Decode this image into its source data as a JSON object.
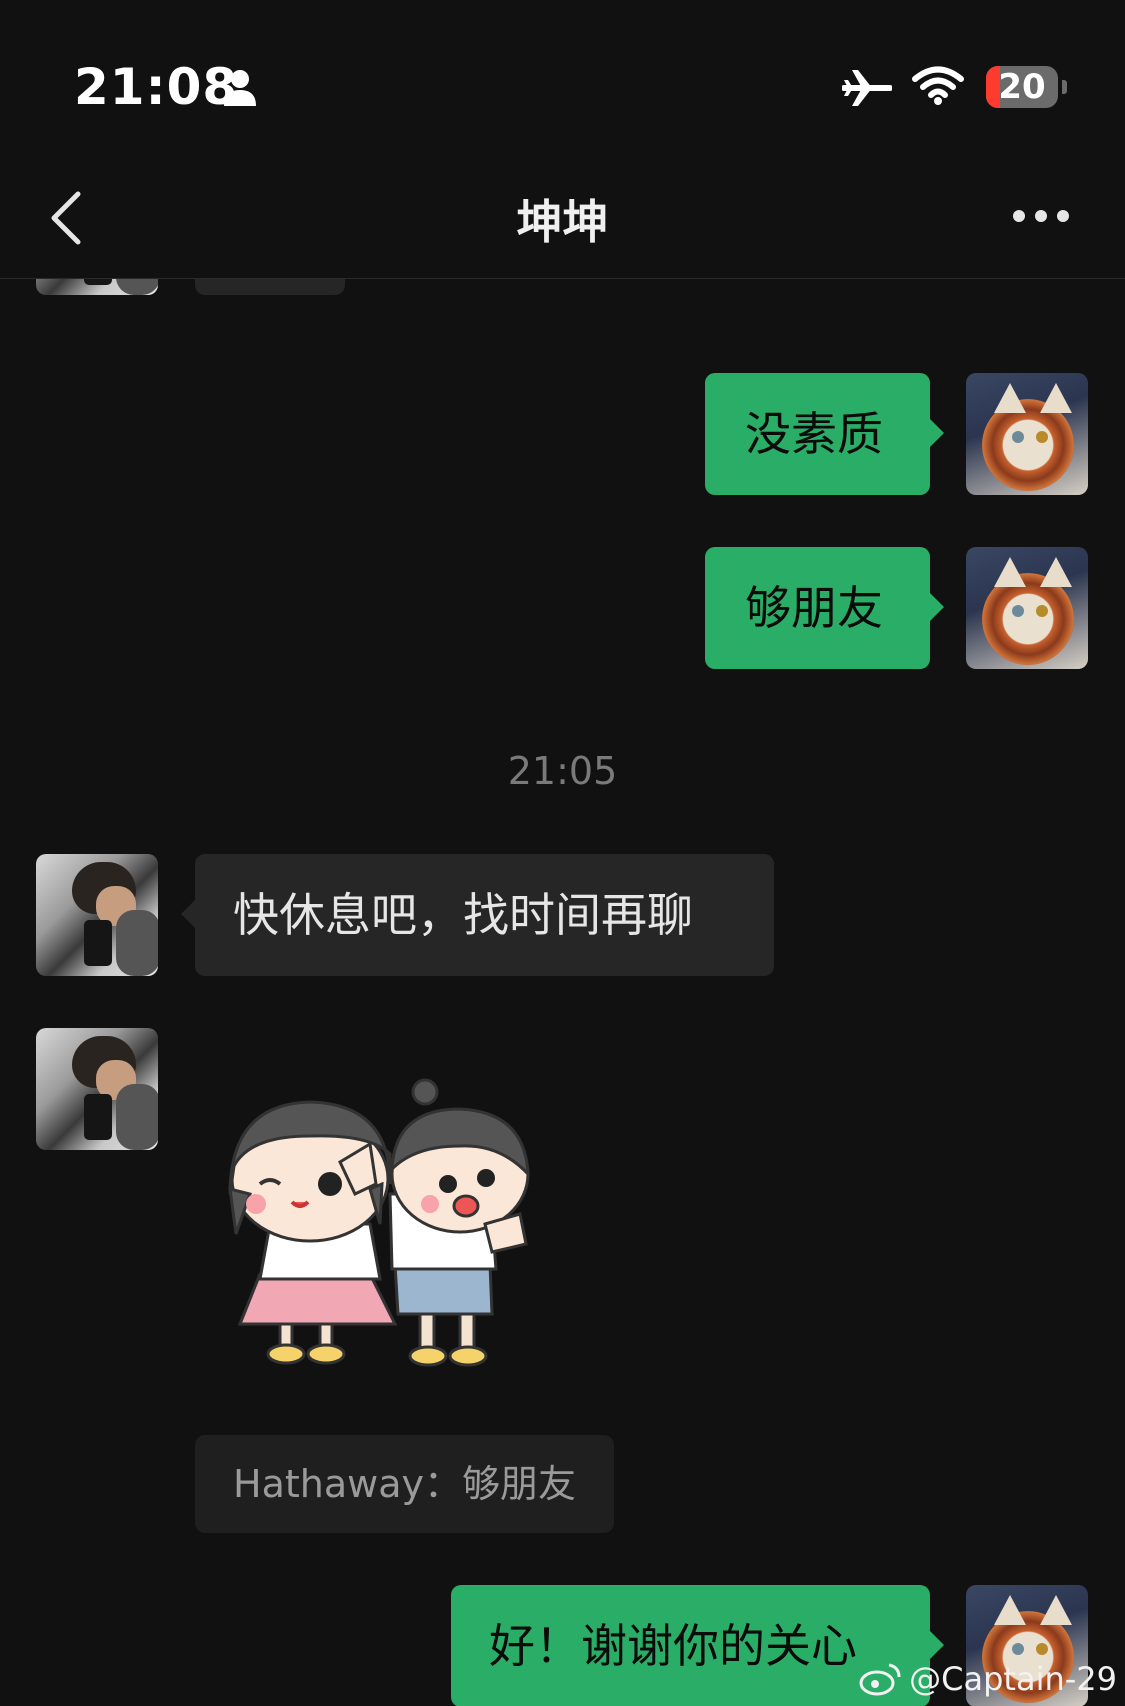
{
  "status_bar": {
    "time": "21:08",
    "battery_level": "20",
    "battery_fraction": 0.2,
    "icons": [
      "person-icon",
      "airplane-mode-icon",
      "wifi-icon",
      "battery-icon"
    ]
  },
  "nav": {
    "title": "坤坤",
    "back_icon": "chevron-left-icon",
    "more_icon": "more-dots-icon"
  },
  "messages": [
    {
      "side": "in",
      "type": "text",
      "text": ""
    },
    {
      "side": "out",
      "type": "text",
      "text": "没素质"
    },
    {
      "side": "out",
      "type": "text",
      "text": "够朋友"
    },
    {
      "type": "timestamp",
      "text": "21:05"
    },
    {
      "side": "in",
      "type": "text",
      "text": "快休息吧，找时间再聊"
    },
    {
      "side": "in",
      "type": "sticker",
      "description_icon": "sticker-two-kids-icon"
    },
    {
      "side": "in",
      "type": "quote",
      "text": "Hathaway：够朋友"
    },
    {
      "side": "out",
      "type": "text",
      "text": "好！谢谢你的关心"
    }
  ],
  "watermark": {
    "text": "@Captain-29",
    "icon": "weibo-icon"
  },
  "colors": {
    "background": "#111111",
    "outgoing_bubble": "#2aae67",
    "incoming_bubble": "#262626",
    "battery_low": "#ff3b30"
  }
}
